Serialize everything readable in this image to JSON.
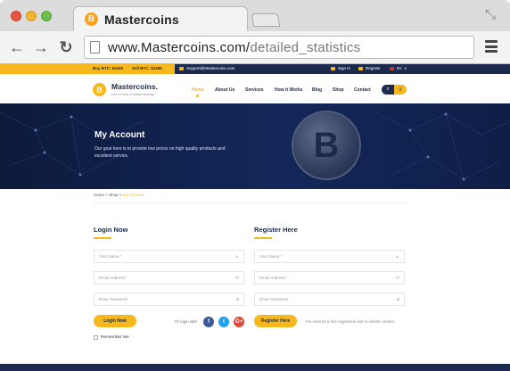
{
  "browser": {
    "tab_title": "Mastercoins",
    "tab_icon_symbol": "B",
    "url_host": "www.Mastercoins.com/",
    "url_path": "detailed_statistics"
  },
  "topbar": {
    "buy_btc": "Buy BTC: $2462",
    "sell_btc": "Sell BTC: $2485",
    "email": "Support@Mastercoins.com",
    "sign_in": "Sign In",
    "register": "Register",
    "language": "En"
  },
  "header": {
    "logo_symbol": "B",
    "logo_name": "Mastercoins.",
    "logo_tagline": "Let's move to smart money",
    "menu": [
      "Home",
      "About Us",
      "Services",
      "How it Works",
      "Blog",
      "Shop",
      "Contact"
    ]
  },
  "hero": {
    "title": "My Account",
    "text": "Our goal here is to provide low prices on high quality products and excellent service.",
    "coin_symbol": "B"
  },
  "breadcrumb": {
    "home": "Home",
    "sep1": ">",
    "shop": "Shop",
    "sep2": ">",
    "current": "My Account"
  },
  "login": {
    "title": "Login Now",
    "fields": [
      "Your Name *",
      "Email Address*",
      "Enter Password"
    ],
    "button": "Login Now",
    "or_login_with": "Or login with",
    "remember": "Remember Me"
  },
  "register": {
    "title": "Register Here",
    "fields": [
      "Your Name *",
      "Email Address*",
      "Enter Password"
    ],
    "button": "Register Here",
    "note": "You must be a free registered user to submit content."
  },
  "social": {
    "facebook": "f",
    "twitter": "t",
    "google": "G+"
  },
  "colors": {
    "navy": "#1b2a4d",
    "accent": "#f6b81c"
  }
}
